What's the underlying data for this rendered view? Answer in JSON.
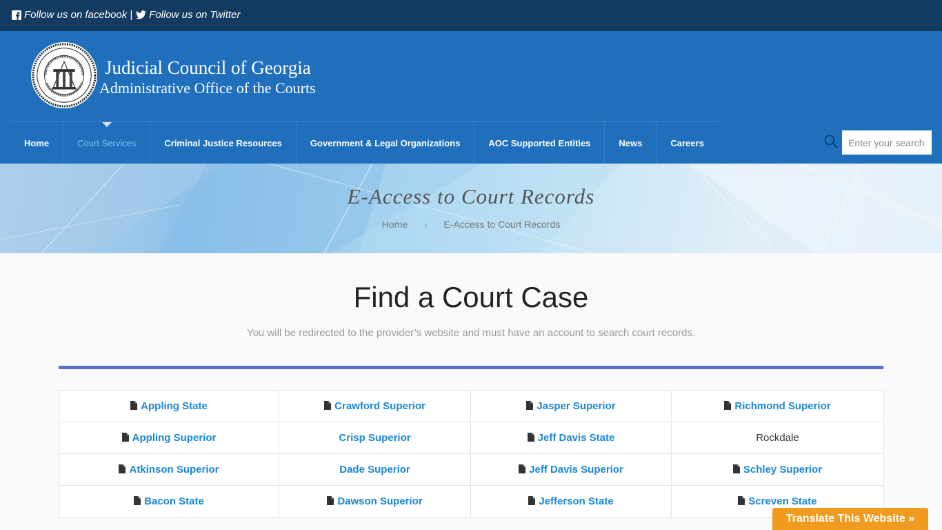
{
  "topbar": {
    "facebook_label": "Follow us on facebook",
    "separator": "|",
    "twitter_label": "Follow us on Twitter"
  },
  "header": {
    "org_name": "Judicial Council of Georgia",
    "org_subtitle": "Administrative Office of the Courts"
  },
  "nav": {
    "items": [
      {
        "label": "Home"
      },
      {
        "label": "Court Services"
      },
      {
        "label": "Criminal Justice Resources"
      },
      {
        "label": "Government & Legal Organizations"
      },
      {
        "label": "AOC Supported Entities"
      },
      {
        "label": "News"
      },
      {
        "label": "Careers"
      }
    ],
    "active": "Court Services"
  },
  "search": {
    "placeholder": "Enter your search"
  },
  "banner": {
    "title": "E-Access to Court Records",
    "breadcrumb_home": "Home",
    "breadcrumb_current": "E-Access to Court Records"
  },
  "main": {
    "title": "Find a Court Case",
    "subtitle": "You will be redirected to the provider’s website and must have an account to search court records."
  },
  "courts": {
    "rows": [
      [
        "Appling State",
        "Crawford Superior",
        "Jasper Superior",
        "Richmond Superior"
      ],
      [
        "Appling Superior",
        "Crisp Superior",
        "Jeff Davis State",
        "Rockdale"
      ],
      [
        "Atkinson Superior",
        "Dade Superior",
        "Jeff Davis Superior",
        "Schley Superior"
      ],
      [
        "Bacon State",
        "Dawson Superior",
        "Jefferson State",
        "Screven State"
      ]
    ]
  },
  "translate": {
    "label": "Translate This Website »"
  },
  "colors": {
    "topbar": "#133a61",
    "header": "#1f6fbc",
    "link": "#1a87d6",
    "divider": "#5b6fc7",
    "translate": "#f09a1f"
  }
}
